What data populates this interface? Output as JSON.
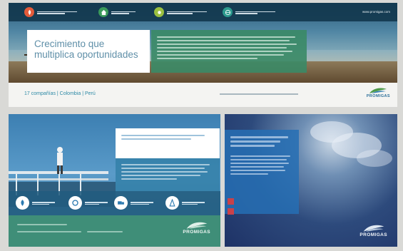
{
  "banner": {
    "headline": "Crecimiento que multiplica oportunidades",
    "site_url": "www.promigas.com",
    "nav": [
      {
        "icon": "flame-icon",
        "color": "#e45b3a"
      },
      {
        "icon": "house-icon",
        "color": "#3a9a5a"
      },
      {
        "icon": "sun-icon",
        "color": "#9ac040"
      },
      {
        "icon": "globe-icon",
        "color": "#2c9a8e"
      }
    ]
  },
  "strip": {
    "companies": "17 compañías | Colombia | Perú",
    "brand": "PROMIGAS"
  },
  "left_panel": {
    "brand": "PROMIGAS",
    "icons": [
      "flame-icon",
      "water-icon",
      "truck-icon",
      "tower-icon"
    ]
  },
  "right_panel": {
    "brand": "PROMIGAS"
  },
  "colors": {
    "accent_blue": "#3b86b8",
    "brand_green": "#3a8a66",
    "alert_red": "#c9414a"
  }
}
